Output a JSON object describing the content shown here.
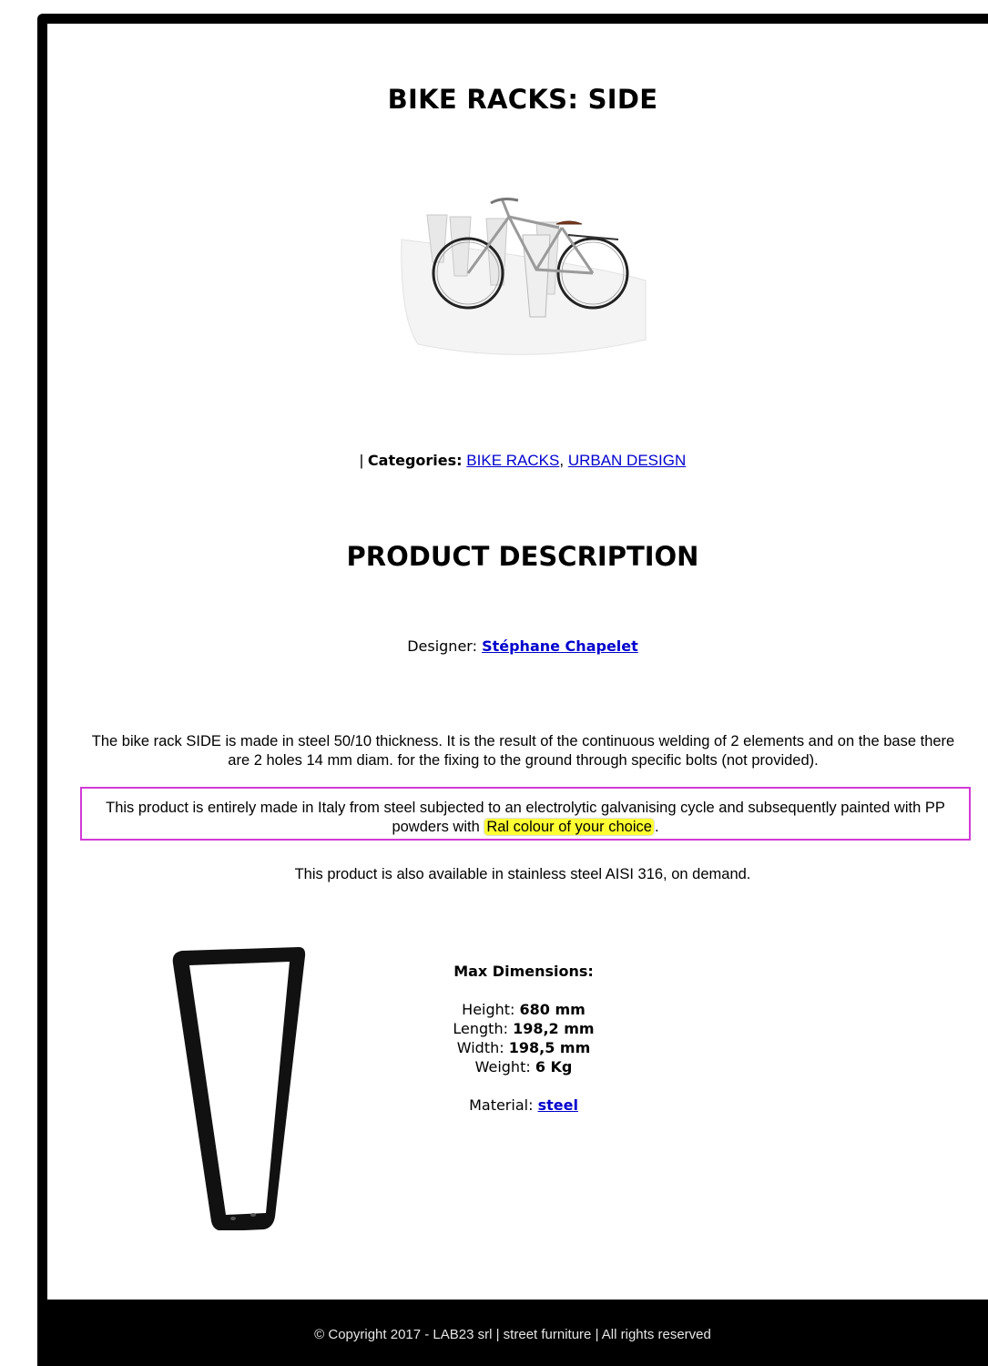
{
  "product": {
    "title": "BIKE RACKS: SIDE",
    "hero_image": "bike-rack-with-bicycle-photo"
  },
  "categories": {
    "prefix": "|",
    "label": "Categories:",
    "items": [
      "BIKE RACKS",
      "URBAN DESIGN"
    ],
    "separator": ","
  },
  "description": {
    "heading": "PRODUCT DESCRIPTION",
    "designer_label": "Designer:",
    "designer_name": "Stéphane Chapelet",
    "paragraph1": "The bike rack SIDE is made in steel 50/10 thickness. It is the result of the continuous welding of 2 elements and on the base there are 2 holes 14 mm diam. for the fixing to the ground through specific bolts (not provided).",
    "paragraph2_before": "This product is entirely made in Italy from steel subjected to an electrolytic galvanising cycle and subsequently painted with PP powders with",
    "paragraph2_highlight": "Ral colour of your choice",
    "paragraph2_after": ".",
    "paragraph3": "This product is also available in stainless steel AISI 316, on demand.",
    "highlight_color": "#ffff33",
    "box_border_color": "#d23ad6"
  },
  "dimensions": {
    "heading": "Max Dimensions:",
    "height_label": "Height:",
    "height_value": "680 mm",
    "length_label": "Length:",
    "length_value": "198,2 mm",
    "width_label": "Width:",
    "width_value": "198,5 mm",
    "weight_label": "Weight:",
    "weight_value": "6 Kg",
    "material_label": "Material:",
    "material_value": "steel"
  },
  "footer": {
    "text": "© Copyright 2017 - LAB23 srl | street furniture | All rights reserved"
  },
  "colors": {
    "link": "#0000cc",
    "frame": "#000000"
  }
}
